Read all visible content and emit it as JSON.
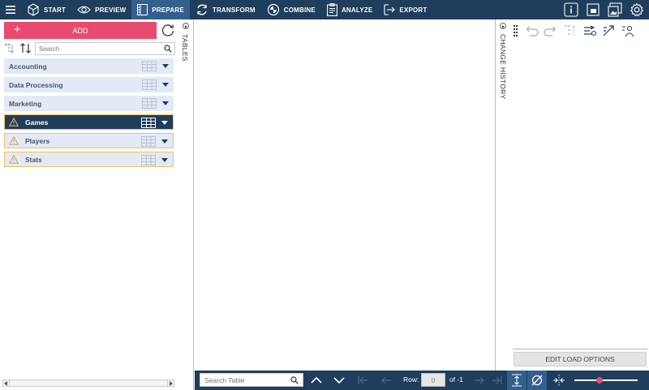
{
  "nav": {
    "items": [
      {
        "label": "START",
        "icon": "cube-icon"
      },
      {
        "label": "PREVIEW",
        "icon": "eye-icon"
      },
      {
        "label": "PREPARE",
        "icon": "table-icon",
        "active": true
      },
      {
        "label": "TRANSFORM",
        "icon": "cycle-icon"
      },
      {
        "label": "COMBINE",
        "icon": "combine-icon"
      },
      {
        "label": "ANALYZE",
        "icon": "clipboard-icon"
      },
      {
        "label": "EXPORT",
        "icon": "export-icon"
      }
    ],
    "right_icons": [
      "info-icon",
      "window-icon",
      "image-help-icon",
      "settings-icon"
    ]
  },
  "left_panel": {
    "add_label": "ADD",
    "search_placeholder": "Search",
    "tables": [
      {
        "name": "Accounting",
        "state": "normal"
      },
      {
        "name": "Data Processing",
        "state": "normal"
      },
      {
        "name": "Marketing",
        "state": "normal"
      },
      {
        "name": "Games",
        "state": "active-warning"
      },
      {
        "name": "Players",
        "state": "warning"
      },
      {
        "name": "Stats",
        "state": "warning"
      }
    ]
  },
  "strips": {
    "tables_label": "TABLES",
    "change_history_label": "CHANGE HISTORY"
  },
  "right_panel": {
    "edit_load_options_label": "EDIT LOAD OPTIONS"
  },
  "bottom_bar": {
    "search_placeholder": "Search Table",
    "row_label": "Row:",
    "row_value": "0",
    "of_label": "of -1",
    "zoom_level": 0.4
  },
  "colors": {
    "nav_bg": "#1f3d5c",
    "nav_active": "#335f8c",
    "accent_pink": "#e84a70",
    "row_bg": "#e3eaf5",
    "warning_border": "#f0c060"
  }
}
